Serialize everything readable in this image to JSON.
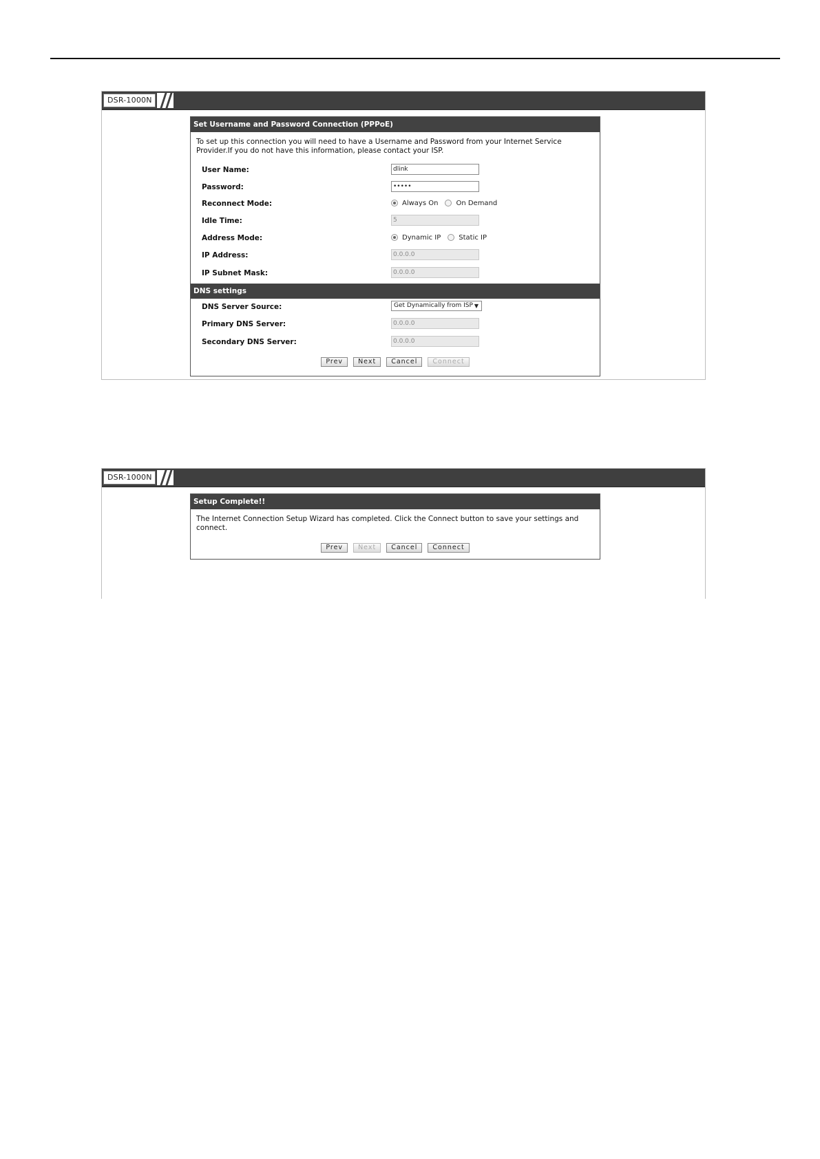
{
  "device_name": "DSR-1000N",
  "screen1": {
    "title": "Set Username and Password Connection (PPPoE)",
    "description": "To set up this connection you will need to have a Username and Password from your Internet Service Provider.If you do not have this information, please contact your ISP.",
    "fields": {
      "user_name": {
        "label": "User Name:",
        "value": "dlink"
      },
      "password": {
        "label": "Password:",
        "value": "•••••"
      },
      "reconnect_mode": {
        "label": "Reconnect Mode:",
        "option_1": "Always On",
        "option_2": "On Demand",
        "selected": "Always On"
      },
      "idle_time": {
        "label": "Idle Time:",
        "value": "5"
      },
      "address_mode": {
        "label": "Address Mode:",
        "option_1": "Dynamic IP",
        "option_2": "Static IP",
        "selected": "Dynamic IP"
      },
      "ip_address": {
        "label": "IP Address:",
        "value": "0.0.0.0"
      },
      "ip_subnet_mask": {
        "label": "IP Subnet Mask:",
        "value": "0.0.0.0"
      }
    },
    "dns_section": {
      "title": "DNS settings",
      "dns_server_source": {
        "label": "DNS Server Source:",
        "value": "Get Dynamically from ISP"
      },
      "primary_dns": {
        "label": "Primary DNS Server:",
        "value": "0.0.0.0"
      },
      "secondary_dns": {
        "label": "Secondary DNS Server:",
        "value": "0.0.0.0"
      }
    },
    "buttons": {
      "prev": "Prev",
      "next": "Next",
      "cancel": "Cancel",
      "connect": "Connect"
    }
  },
  "screen2": {
    "title": "Setup Complete!!",
    "description": "The Internet Connection Setup Wizard has completed. Click the Connect button to save your settings and connect.",
    "buttons": {
      "prev": "Prev",
      "next": "Next",
      "cancel": "Cancel",
      "connect": "Connect"
    }
  },
  "colors": {
    "header_bar": "#424242",
    "panel_border": "#555555"
  }
}
